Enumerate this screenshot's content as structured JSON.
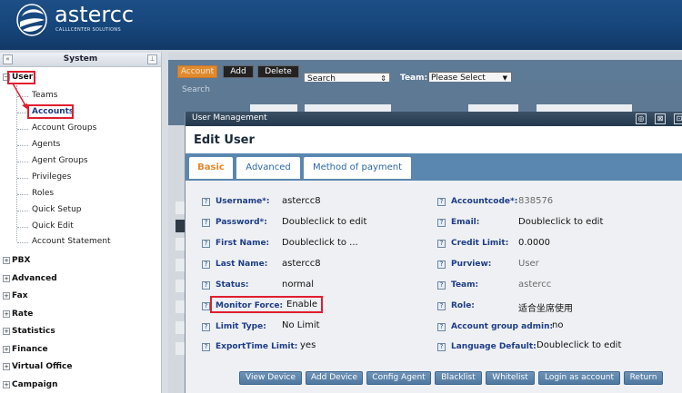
{
  "header": {
    "logo_text": "astercc",
    "logo_subtitle": "CALLLCENTER SOLUTIONS"
  },
  "sidebar": {
    "title": "System",
    "collapse_glyph": "«",
    "pin_glyph": "⊥",
    "root": {
      "label": "User",
      "toggle": "−"
    },
    "user_children": [
      "Teams",
      "Accounts",
      "Account Groups",
      "Agents",
      "Agent Groups",
      "Privileges",
      "Roles",
      "Quick Setup",
      "Quick Edit",
      "Account Statement"
    ],
    "groups": [
      {
        "label": "PBX",
        "toggle": "+"
      },
      {
        "label": "Advanced",
        "toggle": "+"
      },
      {
        "label": "Fax",
        "toggle": "+"
      },
      {
        "label": "Rate",
        "toggle": "+"
      },
      {
        "label": "Statistics",
        "toggle": "+"
      },
      {
        "label": "Finance",
        "toggle": "+"
      },
      {
        "label": "Virtual Office",
        "toggle": "+"
      },
      {
        "label": "Campaign",
        "toggle": "+"
      }
    ],
    "highlight_color": "#e01e2e"
  },
  "toolbar": {
    "account_label": "Account",
    "add_label": "Add",
    "delete_label": "Delete",
    "search_value": "Search",
    "team_label": "Team:",
    "team_select_value": "Please Select"
  },
  "search_strip": {
    "search_label": "Search"
  },
  "modal": {
    "window_title": "User Management",
    "heading": "Edit User",
    "tabs": [
      {
        "label": "Basic",
        "active": true
      },
      {
        "label": "Advanced",
        "active": false
      },
      {
        "label": "Method of payment",
        "active": false
      }
    ],
    "fields_left": [
      {
        "label": "Username*:",
        "value": "astercc8"
      },
      {
        "label": "Password*:",
        "value": "Doubleclick to edit"
      },
      {
        "label": "First Name:",
        "value": "Doubleclick to ..."
      },
      {
        "label": "Last Name:",
        "value": "astercc8"
      },
      {
        "label": "Status:",
        "value": "normal"
      },
      {
        "label": "Monitor Force:",
        "value": "Enable"
      },
      {
        "label": "Limit Type:",
        "value": "No Limit"
      },
      {
        "label": "ExportTime Limit:",
        "value": "yes"
      }
    ],
    "fields_right": [
      {
        "label": "Accountcode*:",
        "value": "838576"
      },
      {
        "label": "Email:",
        "value": "Doubleclick to edit"
      },
      {
        "label": "Credit Limit:",
        "value": "0.0000"
      },
      {
        "label": "Purview:",
        "value": "User"
      },
      {
        "label": "Team:",
        "value": "astercc"
      },
      {
        "label": "Role:",
        "value": "适合坐席使用"
      },
      {
        "label": "Account group admin:",
        "value": "no"
      },
      {
        "label": "Language Default:",
        "value": "Doubleclick to edit"
      }
    ],
    "actions": [
      "View Device",
      "Add Device",
      "Config Agent",
      "Blacklist",
      "Whitelist",
      "Login as account",
      "Return"
    ],
    "help_glyph": "?",
    "window_buttons": [
      "◎",
      "⊠",
      "⊡"
    ]
  },
  "colors": {
    "header_blue": "#16457a",
    "label_blue": "#1d3c87",
    "tab_strip": "#5a87b0",
    "active_tab": "#e8862a",
    "annotation_red": "#e01e2e"
  }
}
